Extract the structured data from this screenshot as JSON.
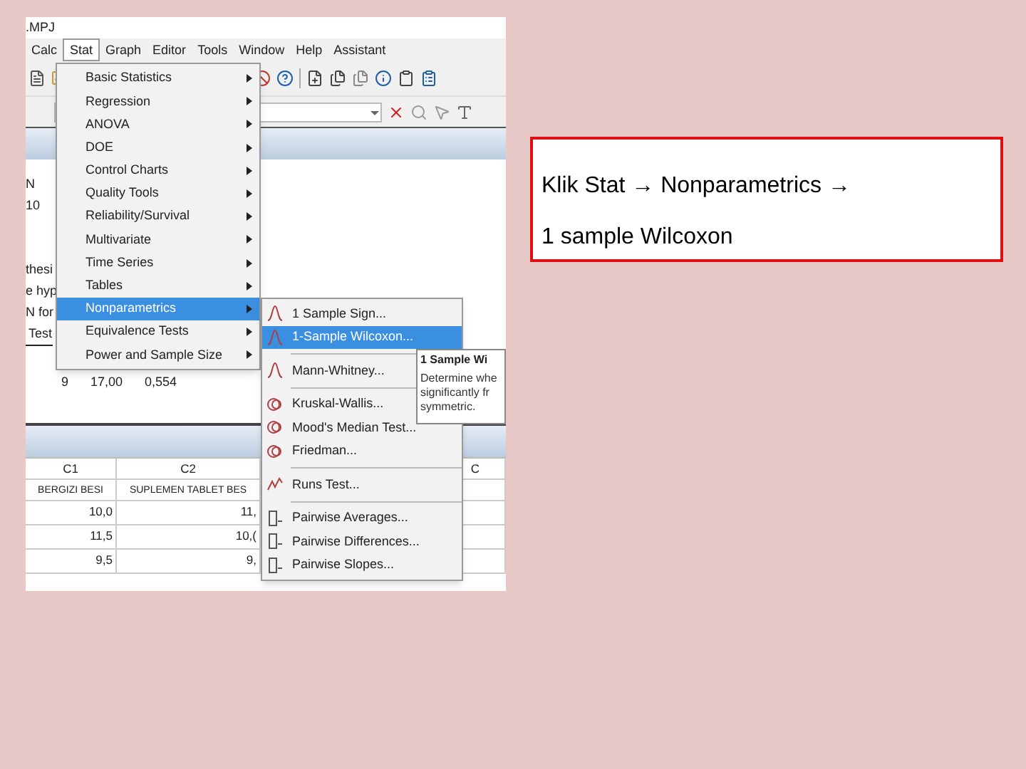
{
  "window": {
    "title": ".MPJ"
  },
  "menubar": [
    {
      "label": "Calc",
      "selected": false
    },
    {
      "label": "Stat",
      "selected": true
    },
    {
      "label": "Graph",
      "selected": false
    },
    {
      "label": "Editor",
      "selected": false
    },
    {
      "label": "Tools",
      "selected": false
    },
    {
      "label": "Window",
      "selected": false
    },
    {
      "label": "Help",
      "selected": false
    },
    {
      "label": "Assistant",
      "selected": false
    }
  ],
  "session": {
    "lines": [
      {
        "kind": "text",
        "cells": [
          "N"
        ]
      },
      {
        "kind": "text",
        "cells": [
          "10"
        ]
      },
      {
        "kind": "gap"
      },
      {
        "kind": "text",
        "cells": [
          "thesi"
        ]
      },
      {
        "kind": "text",
        "cells": [
          "e hyp"
        ]
      },
      {
        "kind": "text",
        "cells": [
          "N for"
        ]
      },
      {
        "kind": "header",
        "cells": [
          "Test"
        ]
      },
      {
        "kind": "values",
        "cells": [
          "9",
          "17,00",
          "0,554"
        ]
      }
    ]
  },
  "stat_menu": [
    {
      "label": "Basic Statistics",
      "selected": false
    },
    {
      "label": "Regression",
      "selected": false
    },
    {
      "label": "ANOVA",
      "selected": false
    },
    {
      "label": "DOE",
      "selected": false
    },
    {
      "label": "Control Charts",
      "selected": false
    },
    {
      "label": "Quality Tools",
      "selected": false
    },
    {
      "label": "Reliability/Survival",
      "selected": false
    },
    {
      "label": "Multivariate",
      "selected": false
    },
    {
      "label": "Time Series",
      "selected": false
    },
    {
      "label": "Tables",
      "selected": false
    },
    {
      "label": "Nonparametrics",
      "selected": true
    },
    {
      "label": "Equivalence Tests",
      "selected": false
    },
    {
      "label": "Power and Sample Size",
      "selected": false
    }
  ],
  "submenu": [
    {
      "label": "1 Sample Sign...",
      "kind": "curve",
      "selected": false,
      "separator_before": false
    },
    {
      "label": "1-Sample Wilcoxon...",
      "kind": "curve",
      "selected": true,
      "separator_before": false
    },
    {
      "label": "Mann-Whitney...",
      "kind": "curve",
      "selected": false,
      "separator_before": true
    },
    {
      "label": "Kruskal-Wallis...",
      "kind": "rings",
      "selected": false,
      "separator_before": true
    },
    {
      "label": "Mood's Median Test...",
      "kind": "rings",
      "selected": false,
      "separator_before": false
    },
    {
      "label": "Friedman...",
      "kind": "rings",
      "selected": false,
      "separator_before": false
    },
    {
      "label": "Runs Test...",
      "kind": "runs",
      "selected": false,
      "separator_before": true
    },
    {
      "label": "Pairwise Averages...",
      "kind": "pairwise",
      "selected": false,
      "separator_before": true
    },
    {
      "label": "Pairwise Differences...",
      "kind": "pairwise",
      "selected": false,
      "separator_before": false
    },
    {
      "label": "Pairwise Slopes...",
      "kind": "pairwise",
      "selected": false,
      "separator_before": false
    }
  ],
  "tooltip": {
    "title": "1 Sample Wi",
    "lines": [
      "Determine whe",
      "significantly fr",
      "symmetric."
    ]
  },
  "worksheet": {
    "columns": [
      "C1",
      "C2",
      "C"
    ],
    "names": [
      "BERGIZI BESI",
      "SUPLEMEN TABLET BES"
    ],
    "rows": [
      [
        "10,0",
        "11,"
      ],
      [
        "11,5",
        "10,("
      ],
      [
        "9,5",
        "9,"
      ]
    ]
  },
  "slide_text": {
    "lines": [
      "Klik Stat → Nonparametrics →",
      "1 sample Wilcoxon"
    ]
  }
}
